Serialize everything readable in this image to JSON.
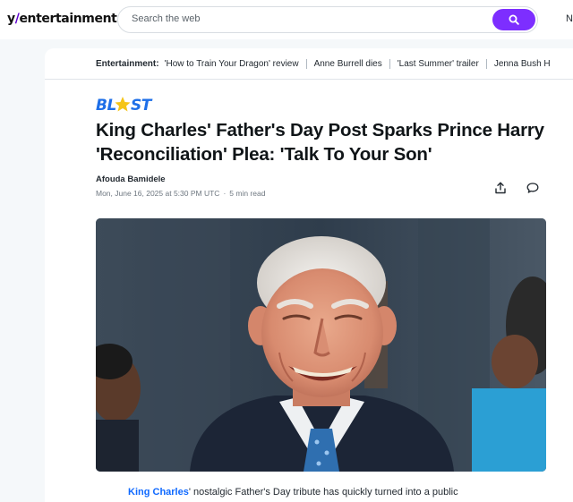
{
  "header": {
    "logo_prefix": "y",
    "logo_slash": "/",
    "logo_text": "entertainment",
    "search_placeholder": "Search the web",
    "right_cut_text": "N"
  },
  "trending": {
    "title": "Entertainment:",
    "items": [
      "'How to Train Your Dragon' review",
      "Anne Burrell dies",
      "'Last Summer' trailer",
      "Jenna Bush H"
    ]
  },
  "article": {
    "brand": "BLAST",
    "headline_line1": "King Charles' Father's Day Post Sparks Prince Harry",
    "headline_line2": "'Reconciliation' Plea: 'Talk To Your Son'",
    "author": "Afouda Bamidele",
    "date": "Mon, June 16, 2025 at 5:30 PM UTC",
    "dot": "·",
    "read_time": "5 min read",
    "body_link": "King Charles",
    "body_rest": "' nostalgic Father's Day tribute has quickly turned into a public"
  },
  "colors": {
    "accent": "#7d2eff",
    "brand_blue": "#1e6fe8",
    "brand_star": "#f5c518",
    "link": "#0f69ff"
  },
  "icons": {
    "search": "search-icon",
    "share": "share-icon",
    "comment": "comment-icon"
  }
}
